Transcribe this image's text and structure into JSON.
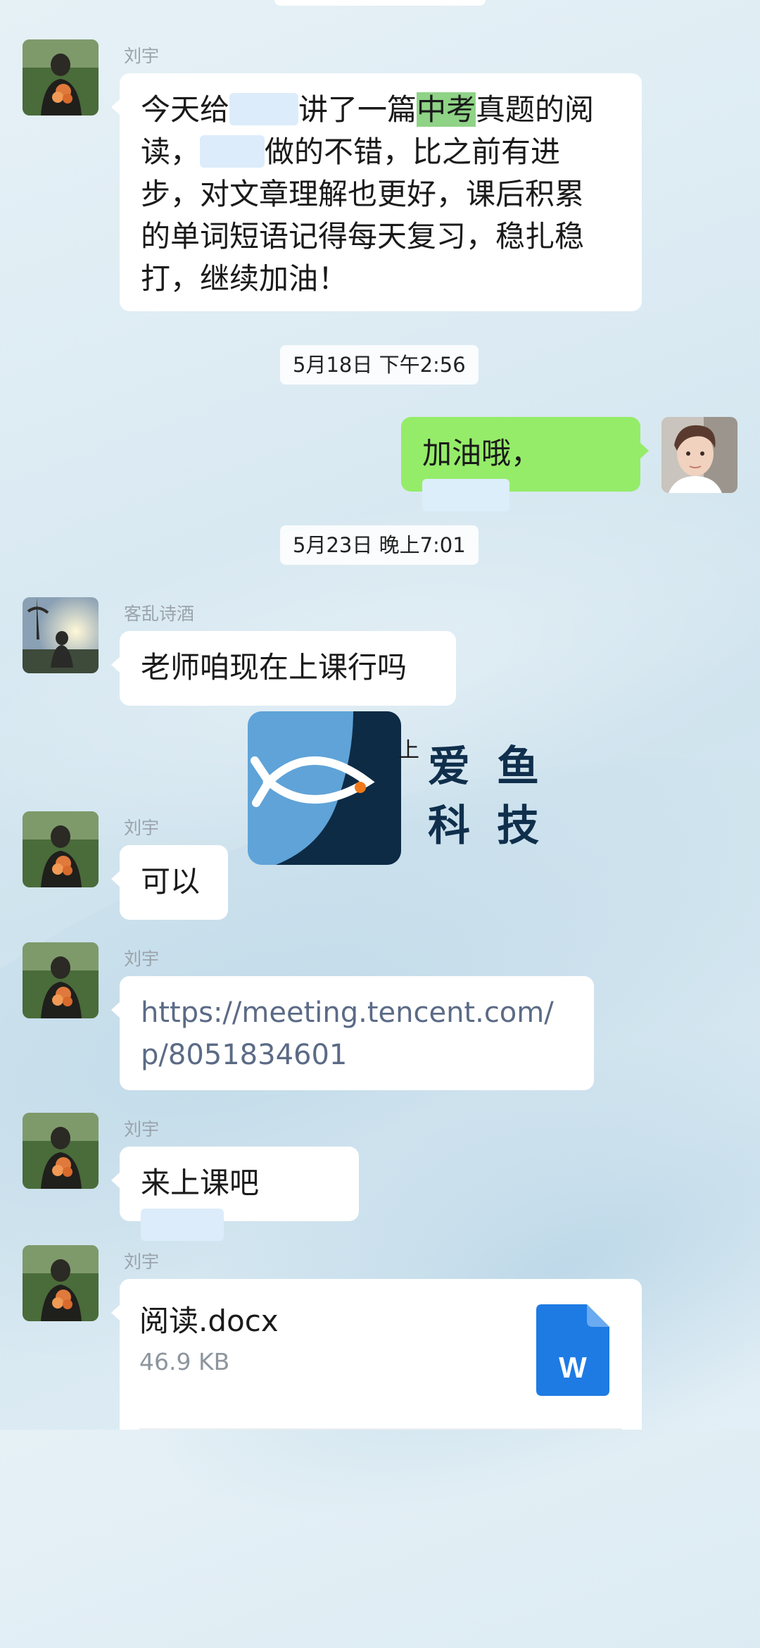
{
  "colors": {
    "my_bubble": "#95ec69",
    "other_bubble": "#ffffff",
    "highlight": "#8fd386",
    "word_icon": "#1e7be3"
  },
  "messages": {
    "m1": {
      "sender": "刘宇",
      "part1": "今天给",
      "part2": "讲了一篇",
      "highlight": "中考",
      "part3": "真题的阅",
      "part4": "读，",
      "part5": "做的不错，比之前有进",
      "line3": "步，对文章理解也更好，课后积累",
      "line4": "的单词短语记得每天复习，稳扎稳",
      "line5": "打，继续加油！"
    },
    "time1": "5月18日 下午2:56",
    "m2": {
      "text": "加油哦，",
      "avatar_icon": "user-avatar-icon"
    },
    "time2": "5月23日 晚上7:01",
    "m3": {
      "sender": "客乱诗酒",
      "text": "老师咱现在上课行吗"
    },
    "m4": {
      "sender": "刘宇",
      "text": "可以"
    },
    "m5": {
      "sender": "刘宇",
      "line1": "https://meeting.tencent.com/",
      "line2": "p/8051834601"
    },
    "m6": {
      "sender": "刘宇",
      "text": "来上课吧"
    },
    "m7": {
      "sender": "刘宇",
      "file_name": "阅读.docx",
      "file_size": "46.9 KB",
      "file_icon_letter": "W"
    }
  },
  "watermark": {
    "line1": "爱鱼",
    "line2": "科技",
    "peek": "上"
  }
}
